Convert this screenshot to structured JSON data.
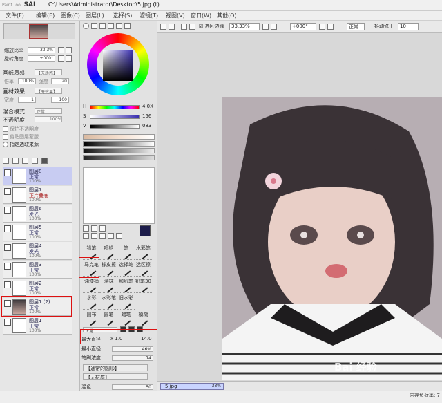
{
  "window": {
    "logo_small": "Paint Tool",
    "logo_big": "SAI",
    "path": "C:\\Users\\Administrator\\Desktop\\5.jpg (t)"
  },
  "menu": [
    "文件(F)",
    "编辑(E)",
    "图像(C)",
    "图层(L)",
    "选择(S)",
    "滤镜(T)",
    "视图(V)",
    "窗口(W)",
    "其他(O)"
  ],
  "navigator": {
    "zoom_label": "缩放比率",
    "zoom_value": "33.3%",
    "angle_label": "旋转角度",
    "angle_value": "+000°"
  },
  "layer_props": {
    "texture_label": "画纸质感",
    "texture_value": "【无质感】",
    "scale_label": "倍率",
    "scale_value": "100%",
    "strength_label": "强度",
    "strength_value": "20",
    "effect_label": "画材效果",
    "effect_value": "【无效果】",
    "width_label": "宽度",
    "width_value": "1",
    "effect_strength_value": "100",
    "blend_label": "混合模式",
    "blend_value": "正常",
    "opacity_label": "不透明度",
    "opacity_value": "100%",
    "protect_label": "保护不透明度",
    "clip_label": "剪贴图层蒙版",
    "source_label": "指定选取来源"
  },
  "layers": [
    {
      "name": "图层8",
      "mode": "正常",
      "opacity": "100%",
      "selected": true
    },
    {
      "name": "图层7",
      "mode": "正片叠底",
      "opacity": "100%",
      "selected": false
    },
    {
      "name": "图层6",
      "mode": "发光",
      "opacity": "100%",
      "selected": false
    },
    {
      "name": "图层5",
      "mode": "正常",
      "opacity": "100%",
      "selected": false
    },
    {
      "name": "图层4",
      "mode": "发光",
      "opacity": "100%",
      "selected": false
    },
    {
      "name": "图层3",
      "mode": "正常",
      "opacity": "100%",
      "selected": false
    },
    {
      "name": "图层2",
      "mode": "正常",
      "opacity": "100%",
      "selected": false
    },
    {
      "name": "图层1 (2)",
      "mode": "正常",
      "opacity": "100%",
      "selected": false
    },
    {
      "name": "图层1",
      "mode": "正常",
      "opacity": "100%",
      "selected": false
    }
  ],
  "color": {
    "h_label": "H",
    "h_value": "4.0X",
    "s_label": "S",
    "s_value": "156",
    "v_label": "V",
    "v_value": "083"
  },
  "tools": [
    [
      "铅笔",
      "喷枪",
      "笔",
      "水彩笔"
    ],
    [
      "马克笔",
      "橡皮擦",
      "选择笔",
      "选区擦"
    ],
    [
      "油漆桶",
      "涂抹",
      "和纸笔",
      "铅笔30"
    ],
    [
      "水彩",
      "水彩笔",
      "旧水彩",
      ""
    ],
    [
      "圆布",
      "圆笔",
      "蜡笔",
      "模糊"
    ]
  ],
  "brush": {
    "mode_value": "正常",
    "max_label": "最大直径",
    "max_mult": "x 1.0",
    "max_value": "14.0",
    "min_label": "最小直径",
    "min_value": "46%",
    "density_label": "笔刷浓度",
    "density_value": "74",
    "shape_value": "【通常的圆形】",
    "tex_value": "【无材质】",
    "mix_label": "混色",
    "mix_value": "50"
  },
  "toolbar": {
    "selection_edge": "选区边缘",
    "zoom": "33.33%",
    "angle": "+000°",
    "mode": "正常",
    "stab_label": "抖动修正",
    "stab_value": "10"
  },
  "status": {
    "doc_name": "5.jpg",
    "doc_zoom": "33%",
    "memory": "内存负荷率: 7"
  },
  "watermark": "Bai 经验"
}
